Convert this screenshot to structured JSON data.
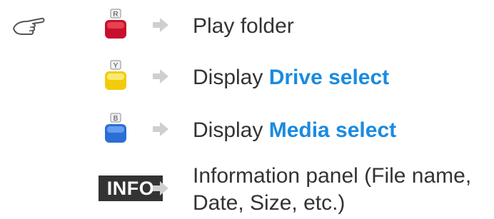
{
  "colors": {
    "red_key": "#c8102e",
    "yellow_key": "#f2cc0c",
    "blue_key": "#2a6fd6",
    "highlight": "#1a8be0",
    "arrow": "#cfcfcf"
  },
  "icons": {
    "pointer": "pointing-hand-icon",
    "arrow": "right-arrow-icon"
  },
  "rows": [
    {
      "key_letter": "R",
      "prefix": "Play folder",
      "highlight": ""
    },
    {
      "key_letter": "Y",
      "prefix": "Display ",
      "highlight": "Drive select"
    },
    {
      "key_letter": "B",
      "prefix": "Display ",
      "highlight": "Media select"
    }
  ],
  "info": {
    "key_label": "INFO",
    "line1": "Information panel (File name,",
    "line2": "Date, Size, etc.)"
  }
}
